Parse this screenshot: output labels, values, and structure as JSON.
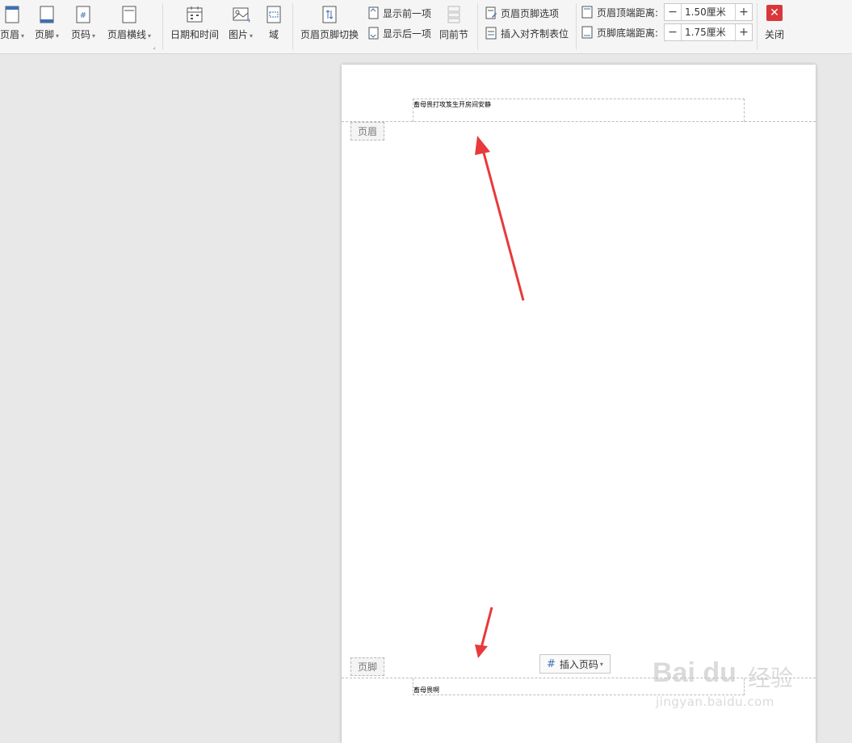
{
  "toolbar": {
    "header_label": "页眉",
    "footer_label": "页脚",
    "page_number_label": "页码",
    "header_line_label": "页眉横线",
    "date_time_label": "日期和时间",
    "picture_label": "图片",
    "field_label": "域",
    "switch_label": "页眉页脚切换",
    "show_prev_label": "显示前一项",
    "show_next_label": "显示后一项",
    "same_as_prev_label": "同前节",
    "options_label": "页眉页脚选项",
    "insert_tab_label": "插入对齐制表位",
    "top_distance_label": "页眉顶端距离:",
    "top_distance_value": "1.50厘米",
    "bottom_distance_label": "页脚底端距离:",
    "bottom_distance_value": "1.75厘米",
    "close_label": "关闭"
  },
  "document": {
    "header_text": "畜母畏打攻笈生开房间安静",
    "header_tag": "页眉",
    "footer_tag": "页脚",
    "footer_text": "畜母畏啊",
    "insert_page_number_label": "插入页码"
  },
  "watermark": {
    "brand": "Bai du",
    "cn": "经验",
    "url": "jingyan.baidu.com"
  },
  "colors": {
    "arrow": "#e83a3a",
    "close": "#d9373b",
    "accent_blue": "#3d6fb6"
  }
}
